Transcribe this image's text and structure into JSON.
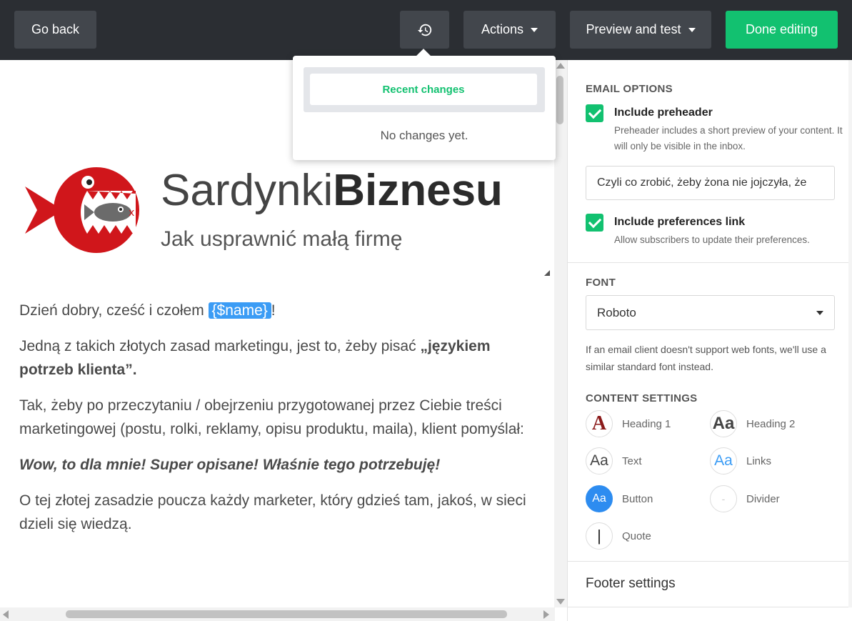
{
  "topbar": {
    "back_label": "Go back",
    "history_icon": "history-icon",
    "actions_label": "Actions",
    "preview_label": "Preview and test",
    "done_label": "Done editing"
  },
  "history_popover": {
    "tab_label": "Recent changes",
    "empty_text": "No changes yet."
  },
  "email": {
    "logo": {
      "brand_light": "Sardynki",
      "brand_bold": "Biznesu",
      "tagline": "Jak usprawnić małą firmę"
    },
    "greeting_prefix": "Dzień dobry, cześć i czołem ",
    "merge_tag": "{$name}",
    "greeting_suffix": "!",
    "p2_text": "Jedną z takich złotych zasad marketingu, jest to, żeby pisać ",
    "p2_bold": "„językiem potrzeb klienta”.",
    "p3": "Tak, żeby po przeczytaniu / obejrzeniu przygotowanej przez Ciebie treści marketingowej (postu, rolki, reklamy, opisu produktu, maila), klient pomyślał:",
    "p4": "Wow, to dla mnie! Super opisane! Właśnie tego potrzebuję!",
    "p5": "O tej złotej zasadzie poucza każdy marketer, który gdzieś tam, jakoś, w sieci dzieli się wiedzą."
  },
  "sidebar": {
    "email_options_title": "EMAIL OPTIONS",
    "preheader_label": "Include preheader",
    "preheader_desc": "Preheader includes a short preview of your content. It will only be visible in the inbox.",
    "preheader_value": "Czyli co zrobić, żeby żona nie jojczyła, że",
    "prefs_label": "Include preferences link",
    "prefs_desc": "Allow subscribers to update their preferences.",
    "font_title": "FONT",
    "font_value": "Roboto",
    "font_note": "If an email client doesn't support web fonts, we'll use a similar standard font instead.",
    "content_title": "CONTENT SETTINGS",
    "content_items": [
      {
        "label": "Heading 1",
        "glyph": "A"
      },
      {
        "label": "Heading 2",
        "glyph": "Aa"
      },
      {
        "label": "Text",
        "glyph": "Aa"
      },
      {
        "label": "Links",
        "glyph": "Aa"
      },
      {
        "label": "Button",
        "glyph": "Aa"
      },
      {
        "label": "Divider",
        "glyph": "-"
      },
      {
        "label": "Quote",
        "glyph": "|"
      }
    ],
    "footer_label": "Footer settings"
  },
  "colors": {
    "topbar_bg": "#2b2e33",
    "button_bg": "#42464c",
    "accent_green": "#12c170",
    "merge_tag_blue": "#3b9cf5",
    "logo_red": "#d0161b"
  }
}
